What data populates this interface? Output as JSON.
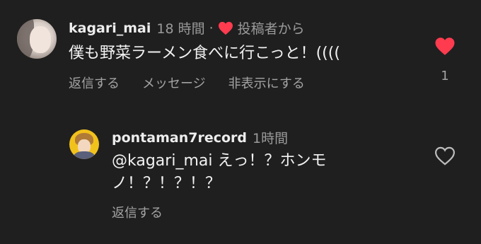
{
  "comments": [
    {
      "username": "kagari_mai",
      "time": "18 時間",
      "separator": "·",
      "author_liked_label": "投稿者から",
      "text": "僕も野菜ラーメン食べに行こっと！((((",
      "actions": [
        "返信する",
        "メッセージ",
        "非表示にする"
      ],
      "like_count": "1",
      "liked": true,
      "avatar_icon": "user-avatar-photo"
    },
    {
      "username": "pontaman7record",
      "time": "1時間",
      "text": "@kagari_mai えっ！？ホンモノ！？！？！？",
      "actions": [
        "返信する"
      ],
      "liked": false,
      "avatar_icon": "user-avatar-photo"
    }
  ],
  "colors": {
    "background": "#1f1f1f",
    "heart_red": "#ff3b4f",
    "secondary_text": "#a3a3a3"
  }
}
